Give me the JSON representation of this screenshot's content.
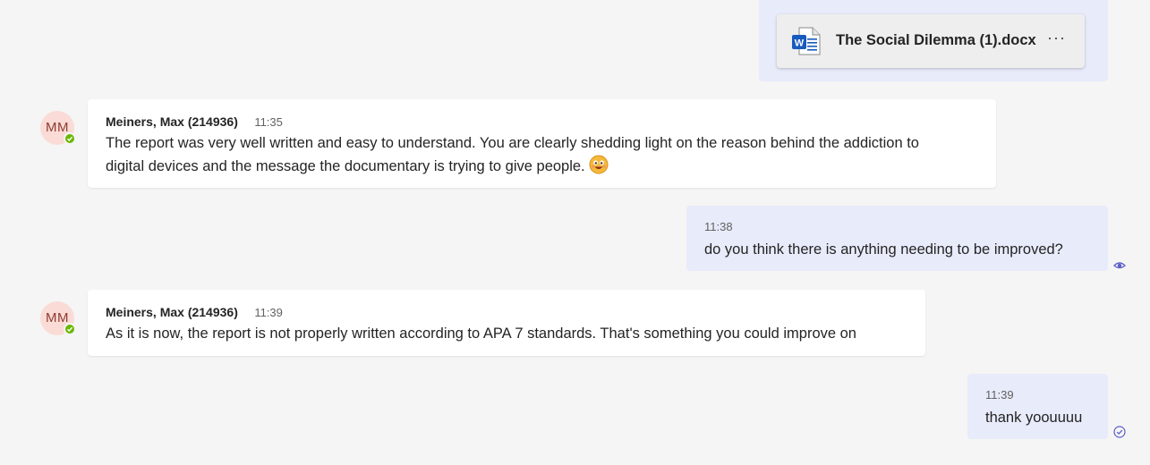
{
  "file_message": {
    "file_name": "The Social Dilemma (1).docx",
    "file_icon": "word-doc-icon",
    "file_icon_letter": "W",
    "more_icon": "more-options-icon",
    "more_glyph": "···"
  },
  "messages": [
    {
      "avatar_initials": "MM",
      "sender": "Meiners, Max (214936)",
      "time": "11:35",
      "text_line1": "The report was very well written and easy to understand. You are clearly shedding light on the reason behind the addiction to",
      "text_line2": "digital devices and the message the documentary is trying to give people.",
      "emoji": "smile-emoji"
    },
    {
      "time": "11:38",
      "text": "do you think there is anything needing to be improved?",
      "status_icon": "seen-eye-icon"
    },
    {
      "avatar_initials": "MM",
      "sender": "Meiners, Max (214936)",
      "time": "11:39",
      "text": "As it is now, the report is not properly written according to APA 7 standards. That's something you could improve on"
    },
    {
      "time": "11:39",
      "text": "thank yoouuuu",
      "status_icon": "sent-check-icon"
    }
  ],
  "colors": {
    "background": "#f5f5f5",
    "self_bubble": "#e8ebfa",
    "other_bubble": "#ffffff",
    "avatar_bg": "#fadbd6",
    "avatar_text": "#8c3b2e",
    "presence": "#6bb700",
    "accent": "#5b5fc7",
    "word_blue": "#185abd"
  }
}
